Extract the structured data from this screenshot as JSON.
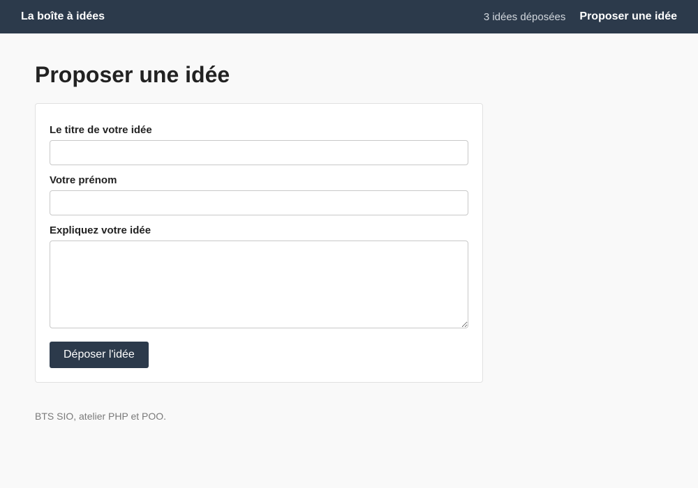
{
  "header": {
    "brand": "La boîte à idées",
    "count_text": "3 idées déposées",
    "propose_link": "Proposer une idée"
  },
  "main": {
    "title": "Proposer une idée",
    "form": {
      "title_label": "Le titre de votre idée",
      "title_value": "",
      "firstname_label": "Votre prénom",
      "firstname_value": "",
      "description_label": "Expliquez votre idée",
      "description_value": "",
      "submit_label": "Déposer l'idée"
    }
  },
  "footer": {
    "text": "BTS SIO, atelier PHP et POO."
  },
  "colors": {
    "topbar": "#2c3a4b",
    "button": "#2c3a4b",
    "background": "#f9f9f9"
  }
}
